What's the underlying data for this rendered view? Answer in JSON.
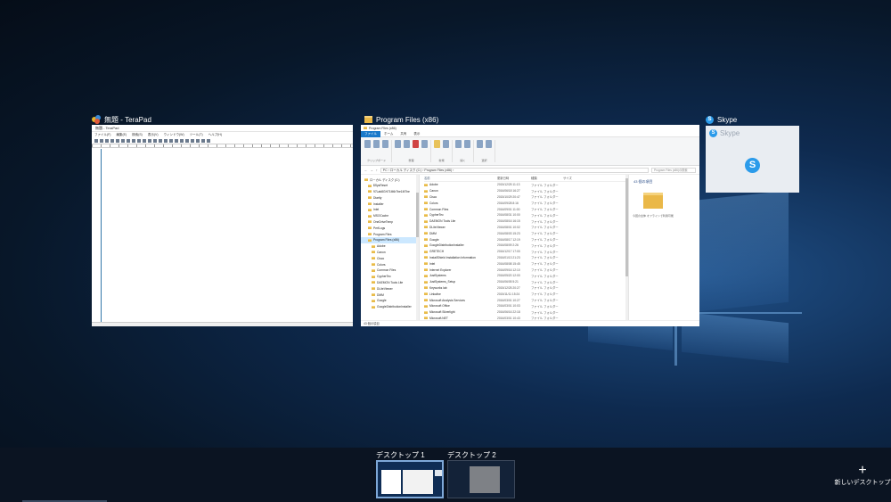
{
  "windows": {
    "terapad": {
      "title": "無題 - TeraPad",
      "inner_title": "無題 - TeraPad",
      "menu": [
        "ファイル(F)",
        "編集(E)",
        "検索(S)",
        "表示(V)",
        "ウィンドウ(W)",
        "ツール(T)",
        "ヘルプ(H)"
      ]
    },
    "explorer": {
      "title": "Program Files (x86)",
      "inner_title": "Program Files (x86)",
      "tabs": [
        "ファイル",
        "ホーム",
        "共有",
        "表示"
      ],
      "ribbon_groups": [
        "クリップボード",
        "整理",
        "新規",
        "開く",
        "選択"
      ],
      "address": "PC › ローカル ディスク (C:) › Program Files (x86) ›",
      "search_placeholder": "Program Files (x86)の検索",
      "nav_items": [
        "ローカル ディスク (C:)",
        "$SysReset",
        "97Lab8GH71M6r7be1M7he",
        "Diarity",
        "Installer",
        "Intel",
        "MSOCache",
        "OneDriveTemp",
        "PerfLogs",
        "Program Files",
        "Program Files (x86)",
        "Adobe",
        "Canon",
        "Cisco",
        "Colors",
        "Common Files",
        "CypherTec",
        "DAEMON Tools Lite",
        "DLiteViewer",
        "DMM",
        "Google",
        "GoogleDistributionInstaller"
      ],
      "selected_nav_index": 10,
      "columns": [
        "名前",
        "更新日時",
        "種類",
        "サイズ"
      ],
      "files": [
        {
          "name": "Adobe",
          "date": "2015/12/25 11:13",
          "type": "ファイル フォルダー"
        },
        {
          "name": "Canon",
          "date": "2016/06/18 16:27",
          "type": "ファイル フォルダー"
        },
        {
          "name": "Cisco",
          "date": "2015/10/29 20:47",
          "type": "ファイル フォルダー"
        },
        {
          "name": "Colors",
          "date": "2016/09/28 8:16",
          "type": "ファイル フォルダー"
        },
        {
          "name": "Common Files",
          "date": "2016/09/01 11:00",
          "type": "ファイル フォルダー"
        },
        {
          "name": "CypherTec",
          "date": "2016/08/31 10:00",
          "type": "ファイル フォルダー"
        },
        {
          "name": "DAEMON Tools Lite",
          "date": "2016/08/16 16:15",
          "type": "ファイル フォルダー"
        },
        {
          "name": "DLiteViewer",
          "date": "2016/08/01 10:02",
          "type": "ファイル フォルダー"
        },
        {
          "name": "DMM",
          "date": "2016/08/03 15:23",
          "type": "ファイル フォルダー"
        },
        {
          "name": "Google",
          "date": "2016/08/17 12:19",
          "type": "ファイル フォルダー"
        },
        {
          "name": "GoogleDistributionInstaller",
          "date": "2016/08/09 2:26",
          "type": "ファイル フォルダー"
        },
        {
          "name": "GRETECH",
          "date": "2016/12/17 17:00",
          "type": "ファイル フォルダー"
        },
        {
          "name": "InstallShield Installation Information",
          "date": "2016/01/13 21:23",
          "type": "ファイル フォルダー"
        },
        {
          "name": "Intel",
          "date": "2016/08/08 15:45",
          "type": "ファイル フォルダー"
        },
        {
          "name": "Internet Explorer",
          "date": "2016/09/16 12:10",
          "type": "ファイル フォルダー"
        },
        {
          "name": "JustSystems",
          "date": "2016/05/20 12:00",
          "type": "ファイル フォルダー"
        },
        {
          "name": "JustSystems_Setup",
          "date": "2016/06/05 5:21",
          "type": "ファイル フォルダー"
        },
        {
          "name": "Keyworks lab",
          "date": "2015/12/25 20:27",
          "type": "ファイル フォルダー"
        },
        {
          "name": "Linkalive",
          "date": "2015/11/11 15:24",
          "type": "ファイル フォルダー"
        },
        {
          "name": "Microsoft Analysis Services",
          "date": "2016/03/01 10:27",
          "type": "ファイル フォルダー"
        },
        {
          "name": "Microsoft Office",
          "date": "2016/03/01 10:03",
          "type": "ファイル フォルダー"
        },
        {
          "name": "Microsoft Silverlight",
          "date": "2016/06/16 22:18",
          "type": "ファイル フォルダー"
        },
        {
          "name": "Microsoft.NET",
          "date": "2016/03/01 10:43",
          "type": "ファイル フォルダー"
        }
      ],
      "detail_count": "43 個の項目",
      "detail_path": "今回の全体  オフラインで利用可能",
      "status": "43 個の項目"
    },
    "skype": {
      "title": "Skype",
      "inner_title": "Skype",
      "logo_letter": "S"
    }
  },
  "desktops": [
    {
      "label": "デスクトップ 1",
      "active": true
    },
    {
      "label": "デスクトップ 2",
      "active": false
    }
  ],
  "new_desktop": {
    "plus": "+",
    "label": "新しいデスクトップ"
  },
  "colors": {
    "accent": "#1979ca",
    "folder": "#eab848",
    "skype": "#2b9bea"
  }
}
